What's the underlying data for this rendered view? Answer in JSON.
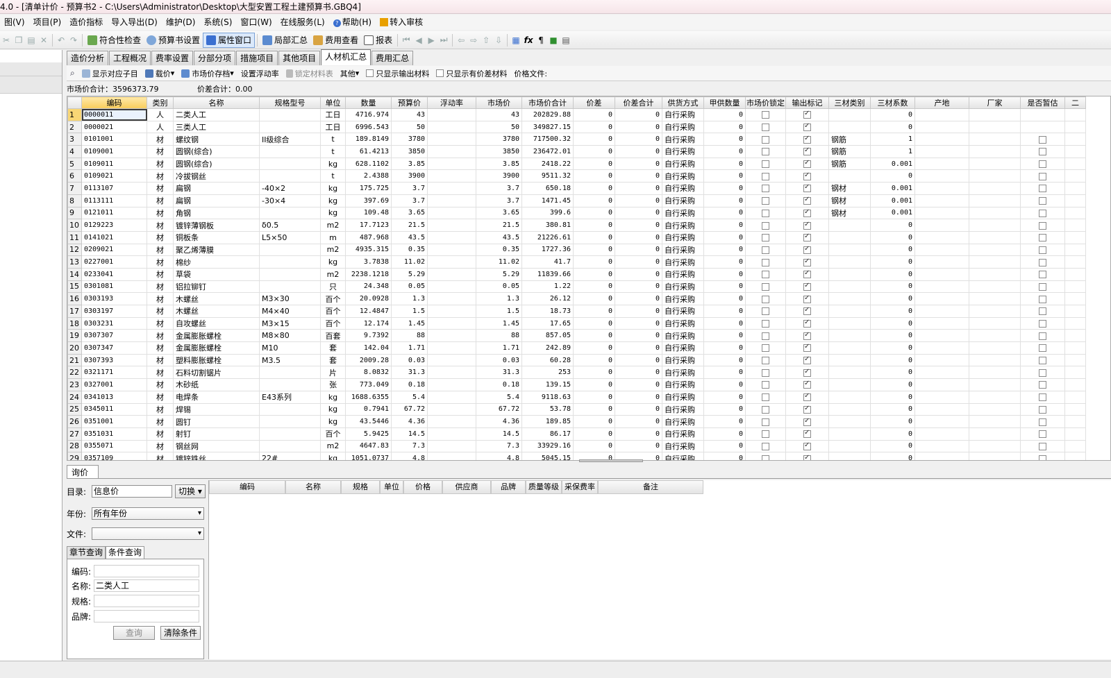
{
  "window": {
    "title": "4.0 - [清单计价 - 预算书2 - C:\\Users\\Administrator\\Desktop\\大型安置工程土建预算书.GBQ4]"
  },
  "menu": [
    "图(V)",
    "项目(P)",
    "造价指标",
    "导入导出(D)",
    "维护(D)",
    "系统(S)",
    "窗口(W)",
    "帮助(H)",
    "转入审核"
  ],
  "menu_extra": "在线服务(L)",
  "toolbar": {
    "check": "符合性检查",
    "budget_settings": "预算书设置",
    "property_window": "属性窗口",
    "local_summary": "局部汇总",
    "fee_view": "费用查看",
    "report": "报表"
  },
  "tabs": [
    "造价分析",
    "工程概况",
    "费率设置",
    "分部分项",
    "措施项目",
    "其他项目",
    "人材机汇总",
    "费用汇总"
  ],
  "active_tab": "人材机汇总",
  "subtoolbar": {
    "show_sub": "显示对应子目",
    "load_price": "载价",
    "market_price_save": "市场价存档",
    "float_rate": "设置浮动率",
    "lock_table": "锁定材料表",
    "other": "其他",
    "only_output": "只显示输出材料",
    "only_diff": "只显示有价差材料",
    "price_file": "价格文件:"
  },
  "summary": {
    "market_total": "市场价合计：3596373.79",
    "diff_total": "价差合计：0.00"
  },
  "columns": [
    "编码",
    "类别",
    "名称",
    "规格型号",
    "单位",
    "数量",
    "预算价",
    "浮动率",
    "市场价",
    "市场价合计",
    "价差",
    "价差合计",
    "供货方式",
    "甲供数量",
    "市场价锁定",
    "输出标记",
    "三材类别",
    "三材系数",
    "产地",
    "厂家",
    "是否暂估",
    "二"
  ],
  "rows": [
    [
      "1",
      "0000011",
      "人",
      "二类人工",
      "",
      "工日",
      "4716.974",
      "43",
      "",
      "43",
      "202829.88",
      "0",
      "0",
      "自行采购",
      "0",
      false,
      true,
      "",
      "0",
      "",
      "",
      false
    ],
    [
      "2",
      "0000021",
      "人",
      "三类人工",
      "",
      "工日",
      "6996.543",
      "50",
      "",
      "50",
      "349827.15",
      "0",
      "0",
      "自行采购",
      "0",
      false,
      true,
      "",
      "0",
      "",
      "",
      false
    ],
    [
      "3",
      "0101001",
      "材",
      "螺纹钢",
      "II级综合",
      "t",
      "189.8149",
      "3780",
      "",
      "3780",
      "717500.32",
      "0",
      "0",
      "自行采购",
      "0",
      false,
      true,
      "钢筋",
      "1",
      "",
      "",
      true
    ],
    [
      "4",
      "0109001",
      "材",
      "圆钢(综合)",
      "",
      "t",
      "61.4213",
      "3850",
      "",
      "3850",
      "236472.01",
      "0",
      "0",
      "自行采购",
      "0",
      false,
      true,
      "钢筋",
      "1",
      "",
      "",
      true
    ],
    [
      "5",
      "0109011",
      "材",
      "圆钢(综合)",
      "",
      "kg",
      "628.1102",
      "3.85",
      "",
      "3.85",
      "2418.22",
      "0",
      "0",
      "自行采购",
      "0",
      false,
      true,
      "钢筋",
      "0.001",
      "",
      "",
      true
    ],
    [
      "6",
      "0109021",
      "材",
      "冷拔钢丝",
      "",
      "t",
      "2.4388",
      "3900",
      "",
      "3900",
      "9511.32",
      "0",
      "0",
      "自行采购",
      "0",
      false,
      true,
      "",
      "0",
      "",
      "",
      true
    ],
    [
      "7",
      "0113107",
      "材",
      "扁钢",
      "-40×2",
      "kg",
      "175.725",
      "3.7",
      "",
      "3.7",
      "650.18",
      "0",
      "0",
      "自行采购",
      "0",
      false,
      true,
      "钢材",
      "0.001",
      "",
      "",
      true
    ],
    [
      "8",
      "0113111",
      "材",
      "扁钢",
      "-30×4",
      "kg",
      "397.69",
      "3.7",
      "",
      "3.7",
      "1471.45",
      "0",
      "0",
      "自行采购",
      "0",
      false,
      true,
      "钢材",
      "0.001",
      "",
      "",
      true
    ],
    [
      "9",
      "0121011",
      "材",
      "角钢",
      "",
      "kg",
      "109.48",
      "3.65",
      "",
      "3.65",
      "399.6",
      "0",
      "0",
      "自行采购",
      "0",
      false,
      true,
      "钢材",
      "0.001",
      "",
      "",
      true
    ],
    [
      "10",
      "0129223",
      "材",
      "镀锌薄钢板",
      "δ0.5",
      "m2",
      "17.7123",
      "21.5",
      "",
      "21.5",
      "380.81",
      "0",
      "0",
      "自行采购",
      "0",
      false,
      true,
      "",
      "0",
      "",
      "",
      true
    ],
    [
      "11",
      "0141021",
      "材",
      "铜板条",
      "L5×50",
      "m",
      "487.968",
      "43.5",
      "",
      "43.5",
      "21226.61",
      "0",
      "0",
      "自行采购",
      "0",
      false,
      true,
      "",
      "0",
      "",
      "",
      true
    ],
    [
      "12",
      "0209021",
      "材",
      "聚乙烯薄膜",
      "",
      "m2",
      "4935.315",
      "0.35",
      "",
      "0.35",
      "1727.36",
      "0",
      "0",
      "自行采购",
      "0",
      false,
      true,
      "",
      "0",
      "",
      "",
      true
    ],
    [
      "13",
      "0227001",
      "材",
      "棉纱",
      "",
      "kg",
      "3.7838",
      "11.02",
      "",
      "11.02",
      "41.7",
      "0",
      "0",
      "自行采购",
      "0",
      false,
      true,
      "",
      "0",
      "",
      "",
      true
    ],
    [
      "14",
      "0233041",
      "材",
      "草袋",
      "",
      "m2",
      "2238.1218",
      "5.29",
      "",
      "5.29",
      "11839.66",
      "0",
      "0",
      "自行采购",
      "0",
      false,
      true,
      "",
      "0",
      "",
      "",
      true
    ],
    [
      "15",
      "0301081",
      "材",
      "铝拉铆钉",
      "",
      "只",
      "24.348",
      "0.05",
      "",
      "0.05",
      "1.22",
      "0",
      "0",
      "自行采购",
      "0",
      false,
      true,
      "",
      "0",
      "",
      "",
      true
    ],
    [
      "16",
      "0303193",
      "材",
      "木螺丝",
      "M3×30",
      "百个",
      "20.0928",
      "1.3",
      "",
      "1.3",
      "26.12",
      "0",
      "0",
      "自行采购",
      "0",
      false,
      true,
      "",
      "0",
      "",
      "",
      true
    ],
    [
      "17",
      "0303197",
      "材",
      "木螺丝",
      "M4×40",
      "百个",
      "12.4847",
      "1.5",
      "",
      "1.5",
      "18.73",
      "0",
      "0",
      "自行采购",
      "0",
      false,
      true,
      "",
      "0",
      "",
      "",
      true
    ],
    [
      "18",
      "0303231",
      "材",
      "自攻螺丝",
      "M3×15",
      "百个",
      "12.174",
      "1.45",
      "",
      "1.45",
      "17.65",
      "0",
      "0",
      "自行采购",
      "0",
      false,
      true,
      "",
      "0",
      "",
      "",
      true
    ],
    [
      "19",
      "0307307",
      "材",
      "金属膨胀螺栓",
      "M8×80",
      "百套",
      "9.7392",
      "88",
      "",
      "88",
      "857.05",
      "0",
      "0",
      "自行采购",
      "0",
      false,
      true,
      "",
      "0",
      "",
      "",
      true
    ],
    [
      "20",
      "0307347",
      "材",
      "金属膨胀螺栓",
      "M10",
      "套",
      "142.04",
      "1.71",
      "",
      "1.71",
      "242.89",
      "0",
      "0",
      "自行采购",
      "0",
      false,
      true,
      "",
      "0",
      "",
      "",
      true
    ],
    [
      "21",
      "0307393",
      "材",
      "塑料膨胀螺栓",
      "M3.5",
      "套",
      "2009.28",
      "0.03",
      "",
      "0.03",
      "60.28",
      "0",
      "0",
      "自行采购",
      "0",
      false,
      true,
      "",
      "0",
      "",
      "",
      true
    ],
    [
      "22",
      "0321171",
      "材",
      "石料切割锯片",
      "",
      "片",
      "8.0832",
      "31.3",
      "",
      "31.3",
      "253",
      "0",
      "0",
      "自行采购",
      "0",
      false,
      true,
      "",
      "0",
      "",
      "",
      true
    ],
    [
      "23",
      "0327001",
      "材",
      "木砂纸",
      "",
      "张",
      "773.049",
      "0.18",
      "",
      "0.18",
      "139.15",
      "0",
      "0",
      "自行采购",
      "0",
      false,
      true,
      "",
      "0",
      "",
      "",
      true
    ],
    [
      "24",
      "0341013",
      "材",
      "电焊条",
      "E43系列",
      "kg",
      "1688.6355",
      "5.4",
      "",
      "5.4",
      "9118.63",
      "0",
      "0",
      "自行采购",
      "0",
      false,
      true,
      "",
      "0",
      "",
      "",
      true
    ],
    [
      "25",
      "0345011",
      "材",
      "焊锡",
      "",
      "kg",
      "0.7941",
      "67.72",
      "",
      "67.72",
      "53.78",
      "0",
      "0",
      "自行采购",
      "0",
      false,
      true,
      "",
      "0",
      "",
      "",
      true
    ],
    [
      "26",
      "0351001",
      "材",
      "圆钉",
      "",
      "kg",
      "43.5446",
      "4.36",
      "",
      "4.36",
      "189.85",
      "0",
      "0",
      "自行采购",
      "0",
      false,
      true,
      "",
      "0",
      "",
      "",
      true
    ],
    [
      "27",
      "0351031",
      "材",
      "射钉",
      "",
      "百个",
      "5.9425",
      "14.5",
      "",
      "14.5",
      "86.17",
      "0",
      "0",
      "自行采购",
      "0",
      false,
      true,
      "",
      "0",
      "",
      "",
      true
    ],
    [
      "28",
      "0355071",
      "材",
      "钢丝网",
      "",
      "m2",
      "4647.83",
      "7.3",
      "",
      "7.3",
      "33929.16",
      "0",
      "0",
      "自行采购",
      "0",
      false,
      true,
      "",
      "0",
      "",
      "",
      true
    ],
    [
      "29",
      "0357109",
      "材",
      "镀锌铁丝",
      "22#",
      "kg",
      "1051.0737",
      "4.8",
      "",
      "4.8",
      "5045.15",
      "0",
      "0",
      "自行采购",
      "0",
      false,
      true,
      "",
      "0",
      "",
      "",
      true
    ]
  ],
  "inquiry": {
    "tab": "询价",
    "catalog_label": "目录:",
    "catalog_value": "信息价",
    "switch": "切换",
    "year_label": "年份:",
    "year_value": "所有年份",
    "file_label": "文件:",
    "file_value": "",
    "subtab_chapter": "章节查询",
    "subtab_condition": "条件查询",
    "code_label": "编码:",
    "code_value": "",
    "name_label": "名称:",
    "name_value": "二类人工",
    "spec_label": "规格:",
    "spec_value": "",
    "brand_label": "品牌:",
    "brand_value": "",
    "query_btn": "查询",
    "clear_btn": "清除条件"
  },
  "info_columns": [
    "编码",
    "名称",
    "规格",
    "单位",
    "价格",
    "供应商",
    "品牌",
    "质量等级",
    "采保费率",
    "备注"
  ]
}
